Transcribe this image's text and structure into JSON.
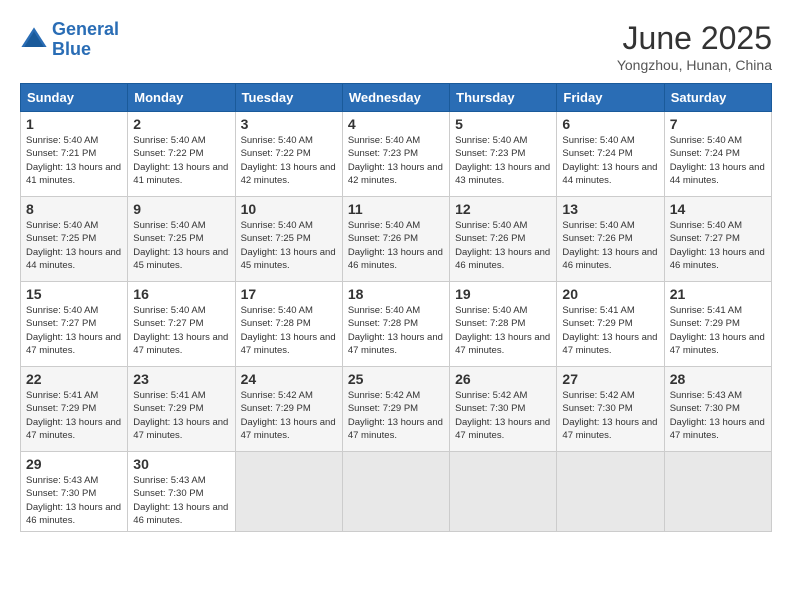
{
  "logo": {
    "line1": "General",
    "line2": "Blue"
  },
  "title": "June 2025",
  "subtitle": "Yongzhou, Hunan, China",
  "weekdays": [
    "Sunday",
    "Monday",
    "Tuesday",
    "Wednesday",
    "Thursday",
    "Friday",
    "Saturday"
  ],
  "weeks": [
    [
      {
        "day": "1",
        "sunrise": "5:40 AM",
        "sunset": "7:21 PM",
        "daylight": "13 hours and 41 minutes."
      },
      {
        "day": "2",
        "sunrise": "5:40 AM",
        "sunset": "7:22 PM",
        "daylight": "13 hours and 41 minutes."
      },
      {
        "day": "3",
        "sunrise": "5:40 AM",
        "sunset": "7:22 PM",
        "daylight": "13 hours and 42 minutes."
      },
      {
        "day": "4",
        "sunrise": "5:40 AM",
        "sunset": "7:23 PM",
        "daylight": "13 hours and 42 minutes."
      },
      {
        "day": "5",
        "sunrise": "5:40 AM",
        "sunset": "7:23 PM",
        "daylight": "13 hours and 43 minutes."
      },
      {
        "day": "6",
        "sunrise": "5:40 AM",
        "sunset": "7:24 PM",
        "daylight": "13 hours and 44 minutes."
      },
      {
        "day": "7",
        "sunrise": "5:40 AM",
        "sunset": "7:24 PM",
        "daylight": "13 hours and 44 minutes."
      }
    ],
    [
      {
        "day": "8",
        "sunrise": "5:40 AM",
        "sunset": "7:25 PM",
        "daylight": "13 hours and 44 minutes."
      },
      {
        "day": "9",
        "sunrise": "5:40 AM",
        "sunset": "7:25 PM",
        "daylight": "13 hours and 45 minutes."
      },
      {
        "day": "10",
        "sunrise": "5:40 AM",
        "sunset": "7:25 PM",
        "daylight": "13 hours and 45 minutes."
      },
      {
        "day": "11",
        "sunrise": "5:40 AM",
        "sunset": "7:26 PM",
        "daylight": "13 hours and 46 minutes."
      },
      {
        "day": "12",
        "sunrise": "5:40 AM",
        "sunset": "7:26 PM",
        "daylight": "13 hours and 46 minutes."
      },
      {
        "day": "13",
        "sunrise": "5:40 AM",
        "sunset": "7:26 PM",
        "daylight": "13 hours and 46 minutes."
      },
      {
        "day": "14",
        "sunrise": "5:40 AM",
        "sunset": "7:27 PM",
        "daylight": "13 hours and 46 minutes."
      }
    ],
    [
      {
        "day": "15",
        "sunrise": "5:40 AM",
        "sunset": "7:27 PM",
        "daylight": "13 hours and 47 minutes."
      },
      {
        "day": "16",
        "sunrise": "5:40 AM",
        "sunset": "7:27 PM",
        "daylight": "13 hours and 47 minutes."
      },
      {
        "day": "17",
        "sunrise": "5:40 AM",
        "sunset": "7:28 PM",
        "daylight": "13 hours and 47 minutes."
      },
      {
        "day": "18",
        "sunrise": "5:40 AM",
        "sunset": "7:28 PM",
        "daylight": "13 hours and 47 minutes."
      },
      {
        "day": "19",
        "sunrise": "5:40 AM",
        "sunset": "7:28 PM",
        "daylight": "13 hours and 47 minutes."
      },
      {
        "day": "20",
        "sunrise": "5:41 AM",
        "sunset": "7:29 PM",
        "daylight": "13 hours and 47 minutes."
      },
      {
        "day": "21",
        "sunrise": "5:41 AM",
        "sunset": "7:29 PM",
        "daylight": "13 hours and 47 minutes."
      }
    ],
    [
      {
        "day": "22",
        "sunrise": "5:41 AM",
        "sunset": "7:29 PM",
        "daylight": "13 hours and 47 minutes."
      },
      {
        "day": "23",
        "sunrise": "5:41 AM",
        "sunset": "7:29 PM",
        "daylight": "13 hours and 47 minutes."
      },
      {
        "day": "24",
        "sunrise": "5:42 AM",
        "sunset": "7:29 PM",
        "daylight": "13 hours and 47 minutes."
      },
      {
        "day": "25",
        "sunrise": "5:42 AM",
        "sunset": "7:29 PM",
        "daylight": "13 hours and 47 minutes."
      },
      {
        "day": "26",
        "sunrise": "5:42 AM",
        "sunset": "7:30 PM",
        "daylight": "13 hours and 47 minutes."
      },
      {
        "day": "27",
        "sunrise": "5:42 AM",
        "sunset": "7:30 PM",
        "daylight": "13 hours and 47 minutes."
      },
      {
        "day": "28",
        "sunrise": "5:43 AM",
        "sunset": "7:30 PM",
        "daylight": "13 hours and 47 minutes."
      }
    ],
    [
      {
        "day": "29",
        "sunrise": "5:43 AM",
        "sunset": "7:30 PM",
        "daylight": "13 hours and 46 minutes."
      },
      {
        "day": "30",
        "sunrise": "5:43 AM",
        "sunset": "7:30 PM",
        "daylight": "13 hours and 46 minutes."
      },
      null,
      null,
      null,
      null,
      null
    ]
  ]
}
